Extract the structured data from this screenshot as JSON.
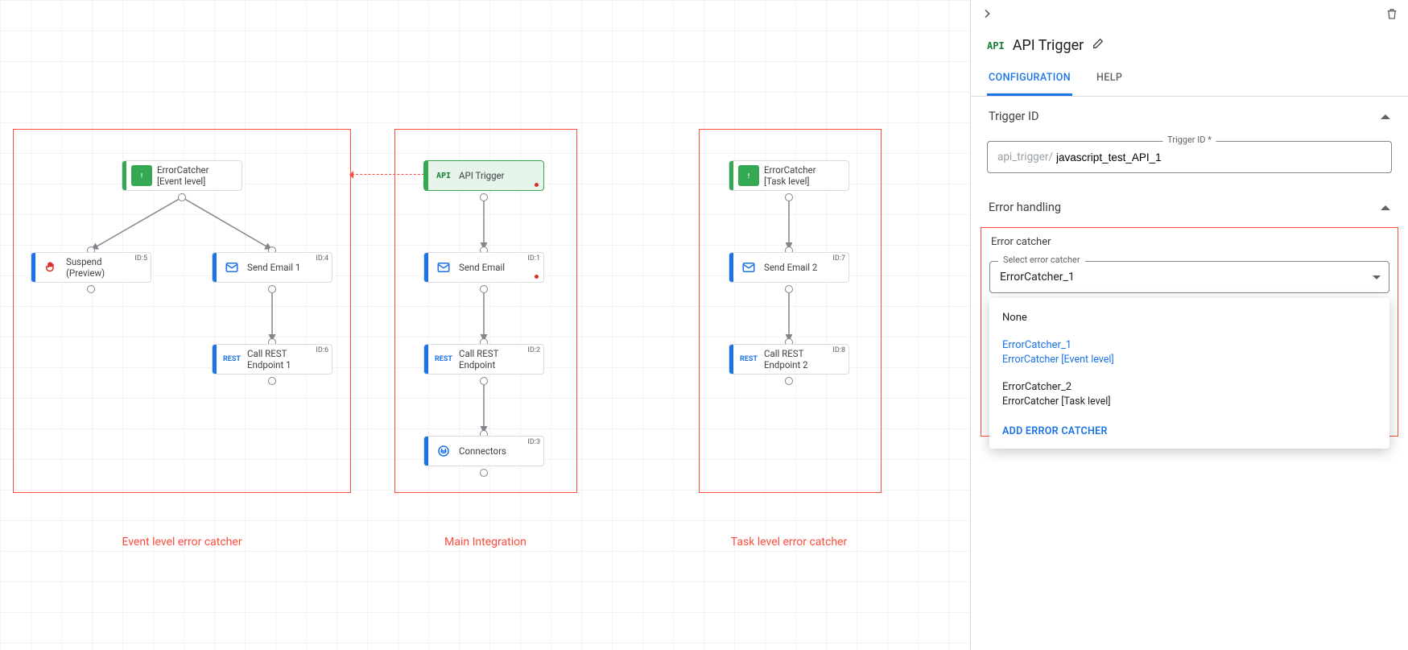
{
  "canvas": {
    "regions": {
      "event": {
        "label": "Event level error catcher"
      },
      "main": {
        "label": "Main Integration"
      },
      "task": {
        "label": "Task level error catcher"
      }
    },
    "nodes": {
      "ec_event": {
        "title": "ErrorCatcher\n[Event level]"
      },
      "suspend": {
        "title": "Suspend\n(Preview)",
        "id": "ID:5"
      },
      "send_email_1": {
        "title": "Send Email 1",
        "id": "ID:4"
      },
      "rest_1": {
        "title": "Call REST\nEndpoint 1",
        "id": "ID:6"
      },
      "api_trigger": {
        "title": "API Trigger"
      },
      "send_email": {
        "title": "Send Email",
        "id": "ID:1"
      },
      "rest_main": {
        "title": "Call REST\nEndpoint",
        "id": "ID:2"
      },
      "connectors": {
        "title": "Connectors",
        "id": "ID:3"
      },
      "ec_task": {
        "title": "ErrorCatcher\n[Task level]"
      },
      "send_email_2": {
        "title": "Send Email 2",
        "id": "ID:7"
      },
      "rest_2": {
        "title": "Call REST\nEndpoint 2",
        "id": "ID:8"
      }
    }
  },
  "panel": {
    "title": "API Trigger",
    "tabs": {
      "config": "CONFIGURATION",
      "help": "HELP"
    },
    "trigger_section": "Trigger ID",
    "trigger_field_label": "Trigger ID *",
    "trigger_prefix": "api_trigger/",
    "trigger_value": "javascript_test_API_1",
    "error_section": "Error handling",
    "error_catcher_label": "Error catcher",
    "select_label": "Select error catcher",
    "select_value": "ErrorCatcher_1",
    "dropdown": {
      "none": "None",
      "opt1_name": "ErrorCatcher_1",
      "opt1_sub": "ErrorCatcher [Event level]",
      "opt2_name": "ErrorCatcher_2",
      "opt2_sub": "ErrorCatcher [Task level]",
      "add": "ADD ERROR CATCHER"
    }
  }
}
